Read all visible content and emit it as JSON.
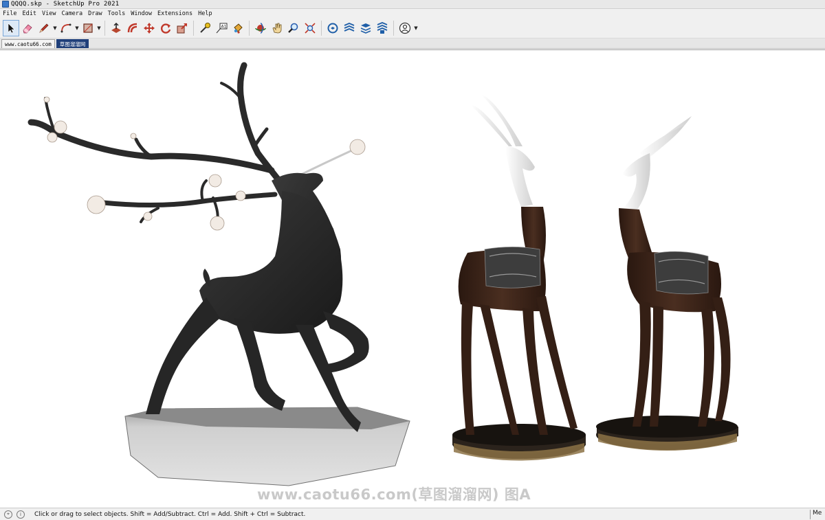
{
  "window": {
    "title": "QQQQ.skp - SketchUp Pro 2021"
  },
  "menu": {
    "items": [
      "File",
      "Edit",
      "View",
      "Camera",
      "Draw",
      "Tools",
      "Window",
      "Extensions",
      "Help"
    ]
  },
  "toolbar": {
    "tools": [
      {
        "name": "select-tool",
        "icon": "cursor-arrow-icon",
        "selected": true
      },
      {
        "name": "eraser-tool",
        "icon": "eraser-icon"
      },
      {
        "name": "line-tool",
        "icon": "pencil-icon",
        "dropdown": true
      },
      {
        "name": "arc-tool",
        "icon": "arc-icon",
        "dropdown": true
      },
      {
        "name": "rectangle-tool",
        "icon": "rectangle-icon",
        "dropdown": true
      },
      {
        "name": "push-pull-tool",
        "icon": "push-pull-icon"
      },
      {
        "name": "offset-tool",
        "icon": "offset-icon"
      },
      {
        "name": "move-tool",
        "icon": "move-arrows-icon"
      },
      {
        "name": "rotate-tool",
        "icon": "rotate-icon"
      },
      {
        "name": "scale-tool",
        "icon": "scale-icon"
      },
      {
        "name": "tape-measure-tool",
        "icon": "tape-measure-icon"
      },
      {
        "name": "text-tool",
        "icon": "text-label-icon"
      },
      {
        "name": "paint-bucket-tool",
        "icon": "paint-bucket-icon"
      },
      {
        "name": "orbit-tool",
        "icon": "orbit-icon"
      },
      {
        "name": "pan-tool",
        "icon": "hand-pan-icon"
      },
      {
        "name": "zoom-tool",
        "icon": "magnifier-icon"
      },
      {
        "name": "zoom-extents-tool",
        "icon": "zoom-extents-icon"
      },
      {
        "name": "warehouse-tool",
        "icon": "3d-warehouse-icon"
      },
      {
        "name": "extension-warehouse-tool",
        "icon": "extension-warehouse-icon"
      },
      {
        "name": "layout-tool",
        "icon": "layout-send-icon"
      },
      {
        "name": "extension-manager-tool",
        "icon": "extension-manager-icon"
      },
      {
        "name": "account-tool",
        "icon": "user-account-icon",
        "dropdown": true
      }
    ]
  },
  "scene_tabs": [
    {
      "label": "www.caotu66.com",
      "active": false
    },
    {
      "label": "草图溜溜网",
      "active": true
    }
  ],
  "viewport": {
    "watermark": "www.caotu66.com(草图溜溜网) 图A",
    "colors": {
      "deer_body": "#2b2b2b",
      "rock": "#bdbdbd",
      "antelope_body": "#3a2419",
      "antelope_head": "#e9e9e9",
      "saddle": "#3d3d3d",
      "base": "#1e1a16",
      "blossom": "#f2ebe4"
    }
  },
  "status": {
    "message": "Click or drag to select objects. Shift = Add/Subtract. Ctrl = Add. Shift + Ctrl = Subtract.",
    "measurements_label": "Me"
  }
}
